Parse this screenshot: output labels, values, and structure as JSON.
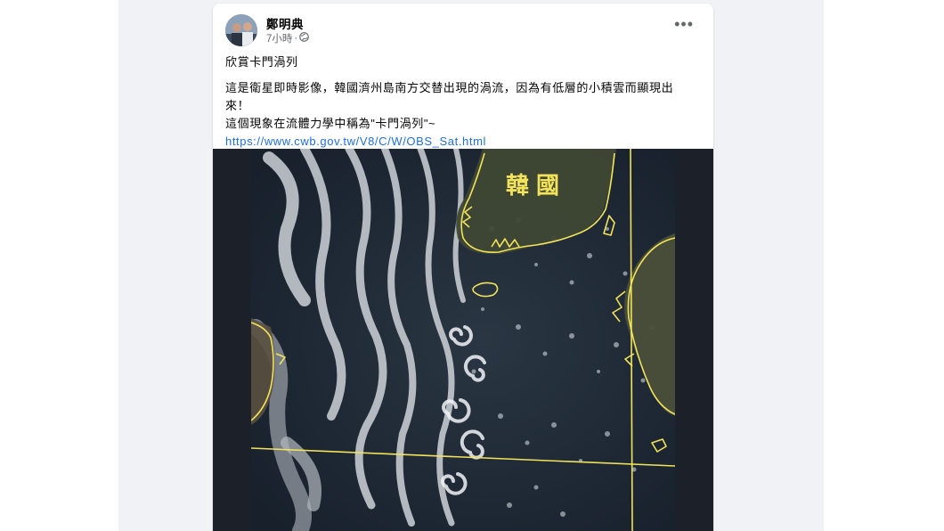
{
  "post": {
    "author": "鄭明典",
    "time": "7小時",
    "separator": "·",
    "privacy_icon": "globe-icon",
    "more_icon": "more-options-icon",
    "more_label": "•••",
    "title": "欣賞卡門渦列",
    "body_line1": "這是衛星即時影像，韓國濟州島南方交替出現的渦流，因為有低層的小積雲而顯現出",
    "body_line2": "來！",
    "body_line3": "這個現象在流體力學中稱為\"卡門渦列\"~",
    "link": "https://www.cwb.gov.tw/V8/C/W/OBS_Sat.html",
    "image_label": "韓國"
  },
  "colors": {
    "page_bg": "#ffffff",
    "feed_bg": "#f0f2f5",
    "link": "#216fdb",
    "map_outline": "#f2e35a",
    "ocean": "#1f2a36"
  }
}
